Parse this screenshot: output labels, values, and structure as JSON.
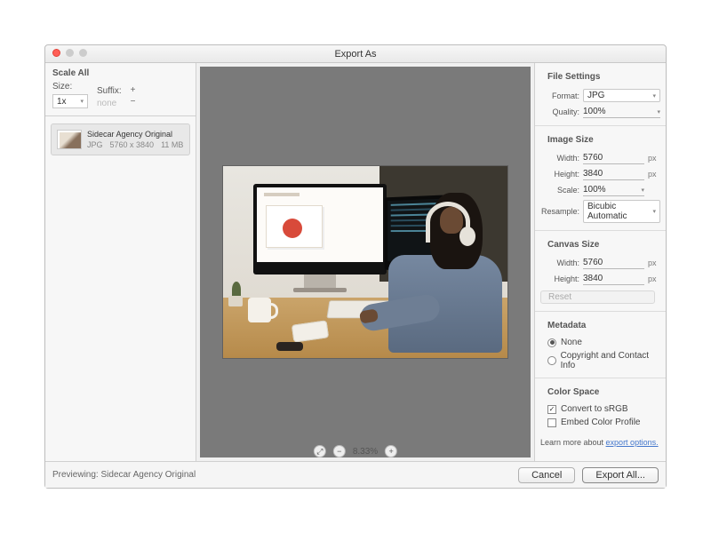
{
  "window": {
    "title": "Export As"
  },
  "left_panel": {
    "header": "Scale All",
    "size_label": "Size:",
    "size_value": "1x",
    "suffix_label": "Suffix:",
    "suffix_value": "none",
    "asset": {
      "name": "Sidecar Agency Original",
      "format": "JPG",
      "dimensions": "5760 x 3840",
      "filesize": "11 MB"
    }
  },
  "right_panel": {
    "file_settings": {
      "header": "File Settings",
      "format_label": "Format:",
      "format_value": "JPG",
      "quality_label": "Quality:",
      "quality_value": "100%"
    },
    "image_size": {
      "header": "Image Size",
      "width_label": "Width:",
      "width_value": "5760",
      "height_label": "Height:",
      "height_value": "3840",
      "scale_label": "Scale:",
      "scale_value": "100%",
      "resample_label": "Resample:",
      "resample_value": "Bicubic Automatic",
      "unit": "px"
    },
    "canvas_size": {
      "header": "Canvas Size",
      "width_label": "Width:",
      "width_value": "5760",
      "height_label": "Height:",
      "height_value": "3840",
      "unit": "px",
      "reset": "Reset"
    },
    "metadata": {
      "header": "Metadata",
      "none": "None",
      "contact": "Copyright and Contact Info"
    },
    "color_space": {
      "header": "Color Space",
      "srgb": "Convert to sRGB",
      "embed": "Embed Color Profile"
    },
    "learn_prefix": "Learn more about ",
    "learn_link": "export options."
  },
  "footer": {
    "preview_prefix": "Previewing:",
    "preview_name": "Sidecar Agency Original",
    "zoom": "8.33%",
    "cancel": "Cancel",
    "export": "Export All..."
  }
}
